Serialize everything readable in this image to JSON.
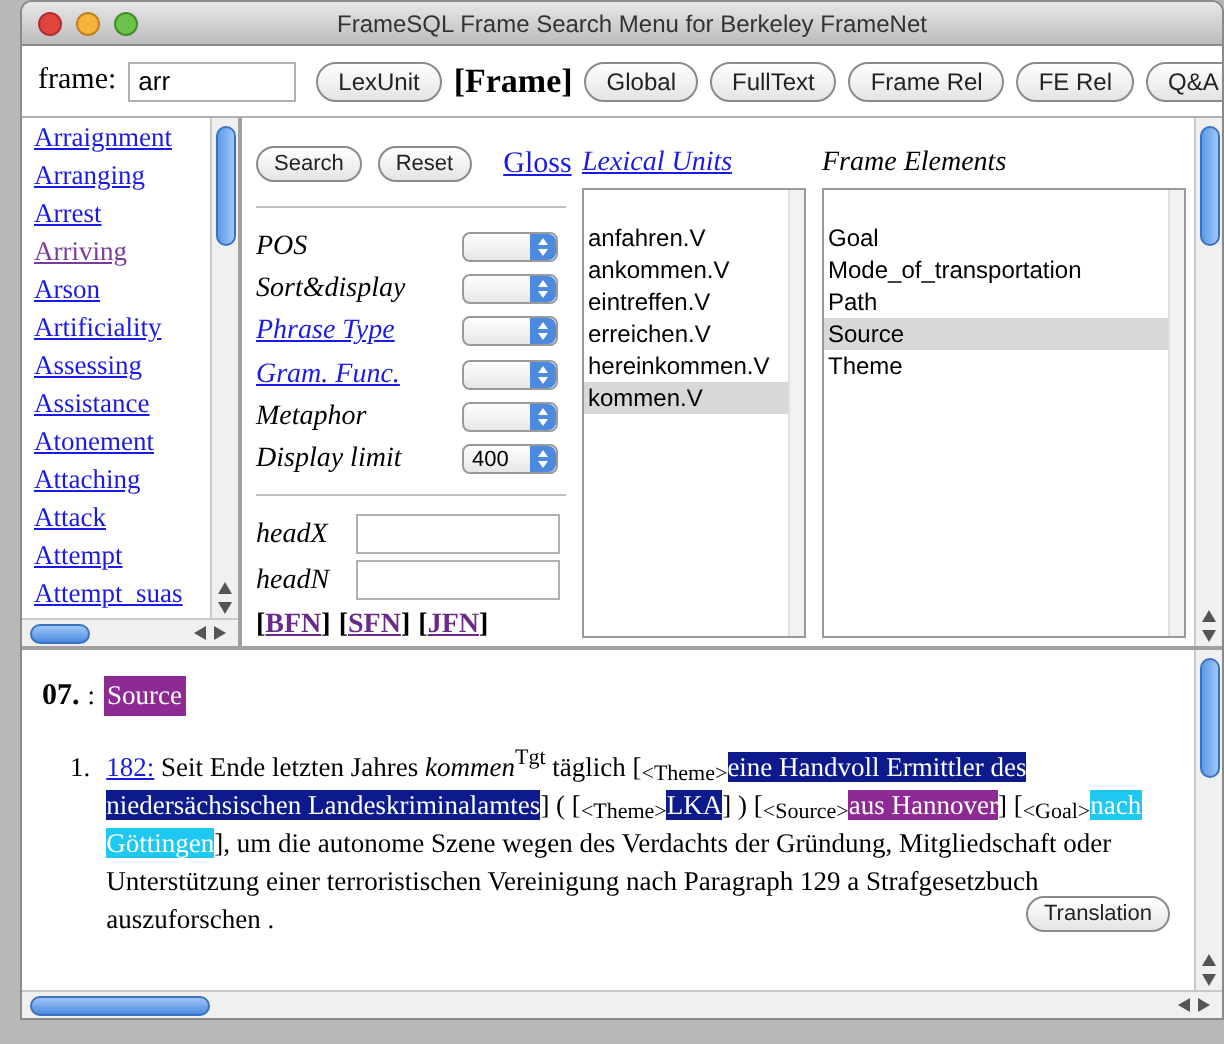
{
  "window": {
    "title": "FrameSQL Frame Search Menu for Berkeley FrameNet"
  },
  "toolbar": {
    "frame_label": "frame:",
    "frame_value": "arr",
    "items": [
      {
        "kind": "button",
        "label": "LexUnit"
      },
      {
        "kind": "current",
        "label": "[Frame]"
      },
      {
        "kind": "button",
        "label": "Global"
      },
      {
        "kind": "button",
        "label": "FullText"
      },
      {
        "kind": "button",
        "label": "Frame Rel"
      },
      {
        "kind": "button",
        "label": "FE Rel"
      },
      {
        "kind": "button",
        "label": "Q&A"
      }
    ]
  },
  "frames": [
    {
      "label": "Arraignment",
      "visited": false
    },
    {
      "label": "Arranging",
      "visited": false
    },
    {
      "label": "Arrest",
      "visited": false
    },
    {
      "label": "Arriving",
      "visited": true
    },
    {
      "label": "Arson",
      "visited": false
    },
    {
      "label": "Artificiality",
      "visited": false
    },
    {
      "label": "Assessing",
      "visited": false
    },
    {
      "label": "Assistance",
      "visited": false
    },
    {
      "label": "Atonement",
      "visited": false
    },
    {
      "label": "Attaching",
      "visited": false
    },
    {
      "label": "Attack",
      "visited": false
    },
    {
      "label": "Attempt",
      "visited": false
    },
    {
      "label": "Attempt_suas",
      "visited": false
    }
  ],
  "search_panel": {
    "buttons": [
      "Search",
      "Reset"
    ],
    "gloss_link": "Gloss",
    "options": [
      {
        "kind": "plain",
        "label": "POS"
      },
      {
        "kind": "plain",
        "label": "Sort&display"
      },
      {
        "kind": "link",
        "label": "Phrase Type"
      },
      {
        "kind": "link",
        "label": "Gram. Func."
      },
      {
        "kind": "plain",
        "label": "Metaphor"
      },
      {
        "kind": "plain",
        "label": "Display limit",
        "value": "400"
      }
    ],
    "head_fields": [
      {
        "label": "headX"
      },
      {
        "label": "headN"
      }
    ],
    "links": [
      {
        "open": "[",
        "label": "BFN",
        "close": "]"
      },
      {
        "open": "[",
        "label": "SFN",
        "close": "]"
      },
      {
        "open": "[",
        "label": "JFN",
        "close": "]"
      }
    ]
  },
  "lexical_units": {
    "heading": "Lexical Units",
    "items": [
      {
        "label": "anfahren.V",
        "selected": false
      },
      {
        "label": "ankommen.V",
        "selected": false
      },
      {
        "label": "eintreffen.V",
        "selected": false
      },
      {
        "label": "erreichen.V",
        "selected": false
      },
      {
        "label": "hereinkommen.V",
        "selected": false
      },
      {
        "label": "kommen.V",
        "selected": true
      }
    ]
  },
  "frame_elements": {
    "heading": "Frame Elements",
    "items": [
      {
        "label": "Goal",
        "selected": false
      },
      {
        "label": "Mode_of_transportation",
        "selected": false
      },
      {
        "label": "Path",
        "selected": false
      },
      {
        "label": "Source",
        "selected": true
      },
      {
        "label": "Theme",
        "selected": false
      }
    ]
  },
  "results": {
    "number": "07.",
    "separator": ":",
    "fe_name": "Source",
    "sentences": [
      {
        "marker": "1.",
        "link": "182:",
        "translation_button": "Translation",
        "segments": [
          {
            "kind": "text",
            "text": "Seit Ende letzten Jahres "
          },
          {
            "kind": "target",
            "text": "kommen",
            "tag": "Tgt"
          },
          {
            "kind": "text",
            "text": " täglich ["
          },
          {
            "kind": "fe",
            "label": "<Theme>",
            "text": "eine Handvoll Ermittler des niedersächsischen Landeskriminalamtes",
            "color": "#0c1a8c"
          },
          {
            "kind": "text",
            "text": "] ( ["
          },
          {
            "kind": "fe",
            "label": "<Theme>",
            "text": "LKA",
            "color": "#0c1a8c"
          },
          {
            "kind": "text",
            "text": "] ) ["
          },
          {
            "kind": "fe",
            "label": "<Source>",
            "text": "aus Hannover",
            "color": "#8e2a94"
          },
          {
            "kind": "text",
            "text": "] ["
          },
          {
            "kind": "fe",
            "label": "<Goal>",
            "text": "nach Göttingen",
            "color": "#1ec8f0"
          },
          {
            "kind": "text",
            "text": "], um die autonome Szene wegen des Verdachts der Gründung, Mitgliedschaft oder Unterstützung einer terroristischen Vereinigung nach Paragraph 129 a Strafgesetzbuch auszuforschen ."
          }
        ]
      }
    ]
  }
}
